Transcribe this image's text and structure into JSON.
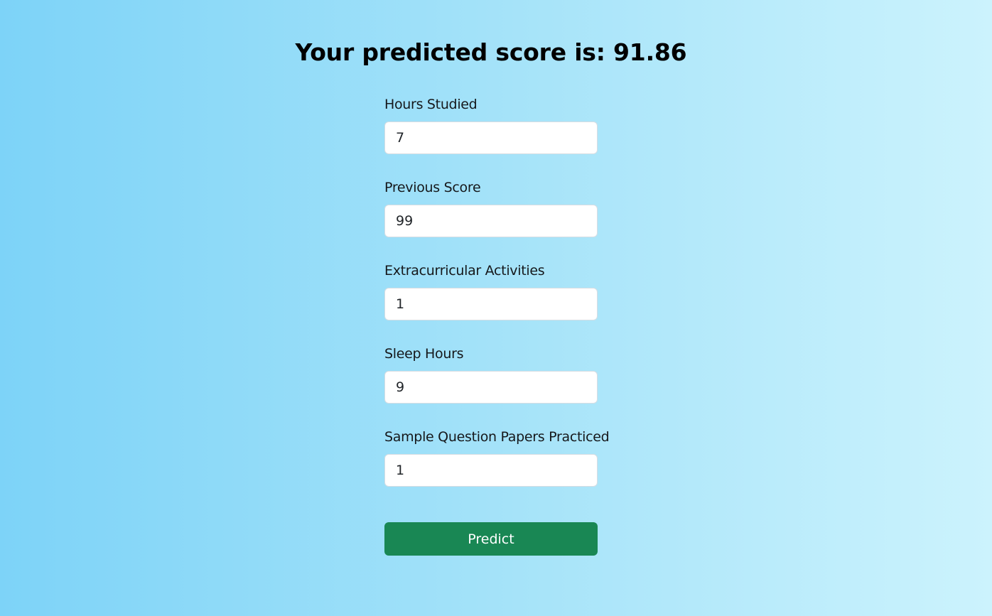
{
  "result": {
    "title": "Your predicted score is: 91.86"
  },
  "form": {
    "fields": [
      {
        "label": "Hours Studied",
        "value": "7"
      },
      {
        "label": "Previous Score",
        "value": "99"
      },
      {
        "label": "Extracurricular Activities",
        "value": "1"
      },
      {
        "label": "Sleep Hours",
        "value": "9"
      },
      {
        "label": "Sample Question Papers Practiced",
        "value": "1"
      }
    ],
    "submit_label": "Predict"
  },
  "colors": {
    "background_left": "#7dd3f8",
    "background_right": "#ccf3fd",
    "button": "#198754",
    "button_text": "#ffffff"
  }
}
